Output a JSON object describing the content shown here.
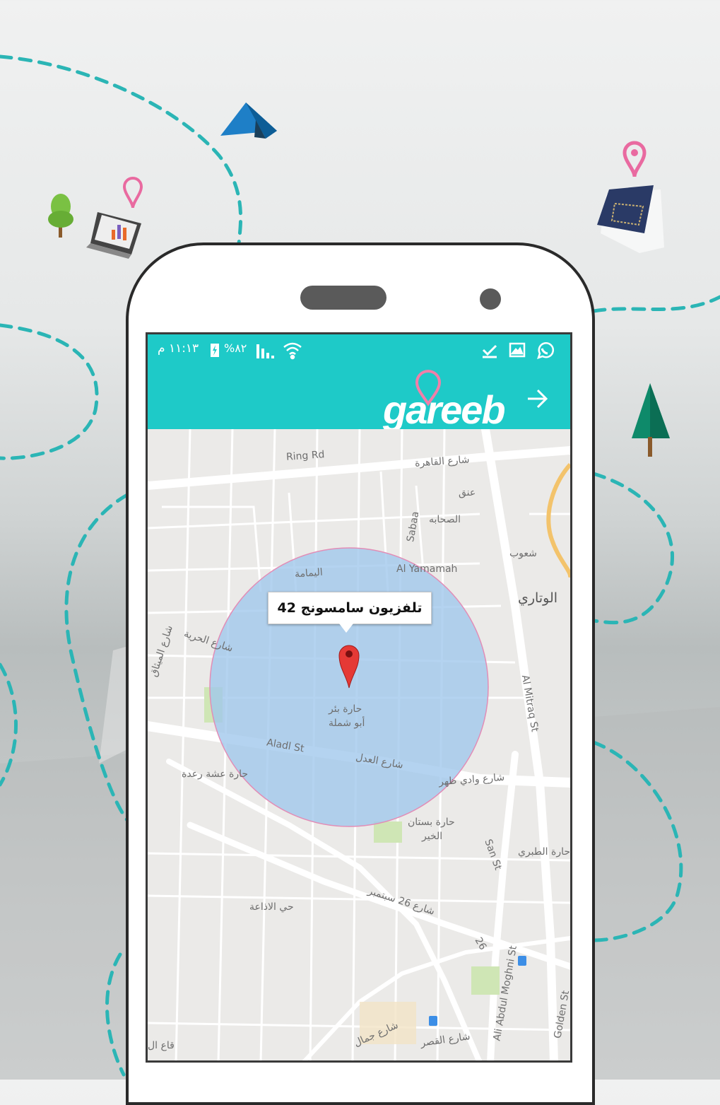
{
  "status_bar": {
    "time": "١١:١٣ م",
    "battery_percent": "%٨٢",
    "icons": [
      "wifi-icon",
      "signal-icon",
      "battery-charging-icon",
      "whatsapp-icon",
      "gallery-icon",
      "download-done-icon"
    ]
  },
  "app_bar": {
    "logo_text": "gareeb",
    "back_icon": "arrow-right-icon"
  },
  "map": {
    "marker_label": "تلفزيون سامسونج 42",
    "radius_color": "#9fc6ec",
    "labels": {
      "ring_rd": "Ring Rd",
      "cairo_st": "شارع القاهرة",
      "aneq": "عنق",
      "sabaa": "Sabaa",
      "sahaba": "الصحابه",
      "al_yamamah": "Al Yamamah",
      "yamamah_ar": "اليمامة",
      "shoub": "شعوب",
      "wotari": "الوتاري",
      "hurriya": "شارع الحرية",
      "mithaq": "شارع الميثاق",
      "hara_bir_1": "حارة بئر",
      "hara_bir_2": "أبو شملة",
      "aladl_st": "Aladl St",
      "aladl_ar": "شارع العدل",
      "ushsh": "حارة عشة رعدة",
      "wadi_dhahr": "شارع وادي ظهر",
      "mitraq": "Al Mitraq St",
      "bustan_1": "حارة بستان",
      "bustan_2": "الخير",
      "san_st": "San St",
      "tabari": "حارة الطبري",
      "idhaa": "حي الاذاعة",
      "sept26": "شارع 26 سبتمبر",
      "num26": "26",
      "abdul_moghni": "Ali Abdul Moghni St",
      "golden": "Golden St",
      "qasr": "شارع القصر",
      "jamal": "شارع جمال",
      "qaa": "قاع ال"
    }
  },
  "background": {
    "decor_icons": [
      "tent-icon",
      "tree-icon",
      "laptop-chart-icon",
      "location-pin-icon",
      "jeans-icon",
      "pine-tree-icon"
    ],
    "path_color": "#2bb5b5"
  }
}
